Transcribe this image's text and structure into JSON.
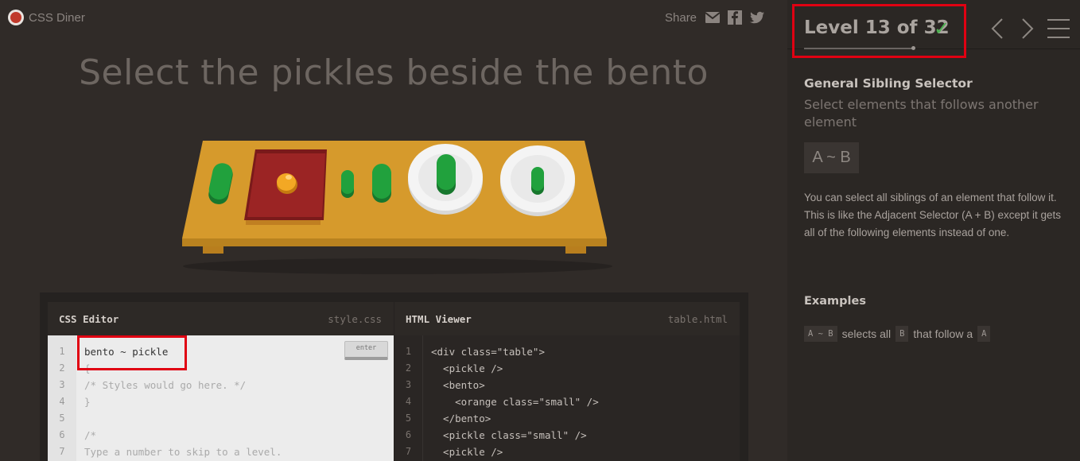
{
  "app": {
    "name": "CSS Diner"
  },
  "share": {
    "label": "Share",
    "icons": [
      "mail-icon",
      "facebook-icon",
      "twitter-icon"
    ]
  },
  "headline": "Select the pickles beside the bento",
  "level": {
    "text": "Level 13 of 32",
    "current": 13,
    "total": 32,
    "completed": true,
    "progress": 0.4
  },
  "sidebar": {
    "selector_name": "General Sibling Selector",
    "selector_title": "Select elements that follows another element",
    "syntax": "A ~ B",
    "hint": "You can select all siblings of an element that follow it. This is like the Adjacent Selector (A + B) except it gets all of the following elements instead of one.",
    "examples_title": "Examples",
    "example": {
      "code1": "A ~ B",
      "text1": "selects all",
      "code2": "B",
      "text2": "that follow a",
      "code3": "A"
    }
  },
  "css_editor": {
    "title": "CSS Editor",
    "file": "style.css",
    "input_value": "bento ~ pickle",
    "enter_label": "enter",
    "line_numbers": [
      "1",
      "2",
      "3",
      "4",
      "5",
      "6",
      "7"
    ],
    "lines": [
      "",
      "{",
      "/* Styles would go here. */",
      "}",
      "",
      "/*",
      "Type a number to skip to a level."
    ]
  },
  "html_viewer": {
    "title": "HTML Viewer",
    "file": "table.html",
    "line_numbers": [
      "1",
      "2",
      "3",
      "4",
      "5",
      "6",
      "7"
    ],
    "lines": [
      "<div class=\"table\">",
      "  <pickle />",
      "  <bento>",
      "    <orange class=\"small\" />",
      "  </bento>",
      "  <pickle class=\"small\" />",
      "  <pickle />"
    ]
  },
  "colors": {
    "background": "#302b28",
    "sidebar": "#2b2724",
    "accent_green": "#4cb050",
    "highlight_red": "#e00012",
    "table": "#d69a2c",
    "pickle": "#1f9a3a",
    "bento": "#8b2020",
    "orange": "#f0a020",
    "plate": "#f2f2f2"
  }
}
